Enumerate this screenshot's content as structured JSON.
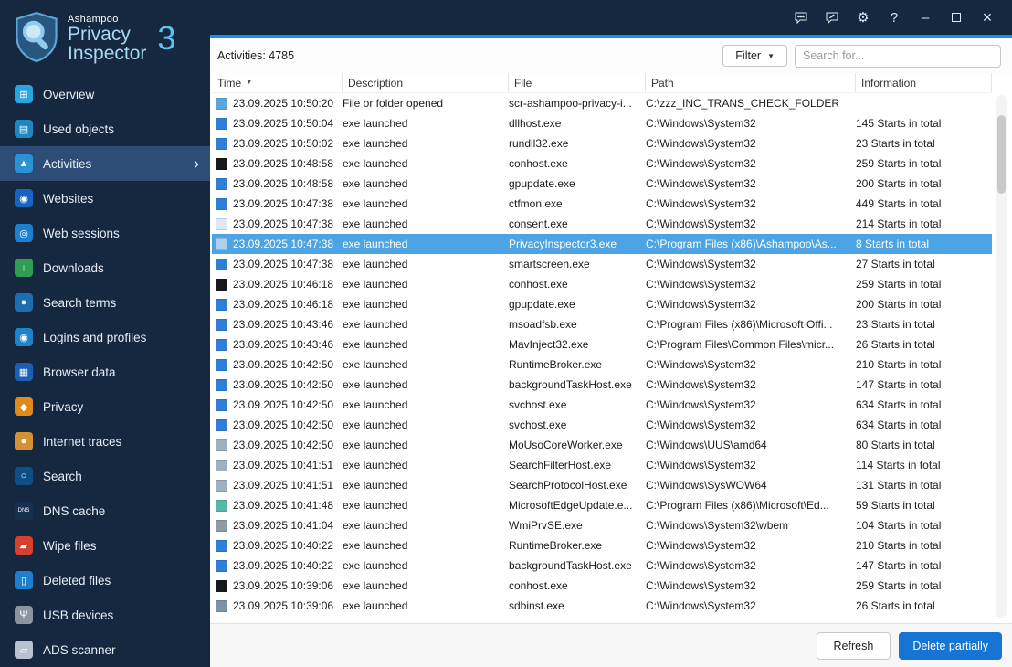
{
  "logo": {
    "brand": "Ashampoo",
    "line1": "Privacy",
    "line2": "Inspector",
    "version": "3"
  },
  "titlebar": {
    "settings_glyph": "⚙",
    "help_glyph": "?",
    "minimize_glyph": "–",
    "close_glyph": "×"
  },
  "sidebar": {
    "chevron": "›",
    "items": [
      {
        "label": "Overview",
        "icon": "overview-icon",
        "color": "#2aa3e0",
        "glyph": "⊞",
        "selected": false
      },
      {
        "label": "Used objects",
        "icon": "used-objects-icon",
        "color": "#1f86c4",
        "glyph": "▤",
        "selected": false
      },
      {
        "label": "Activities",
        "icon": "activities-icon",
        "color": "#2a93d5",
        "glyph": "▲",
        "selected": true
      },
      {
        "label": "Websites",
        "icon": "websites-icon",
        "color": "#1565c0",
        "glyph": "◉",
        "selected": false
      },
      {
        "label": "Web sessions",
        "icon": "web-sessions-icon",
        "color": "#1e7fd0",
        "glyph": "◎",
        "selected": false
      },
      {
        "label": "Downloads",
        "icon": "downloads-icon",
        "color": "#2f9e53",
        "glyph": "↓",
        "selected": false
      },
      {
        "label": "Search terms",
        "icon": "search-terms-icon",
        "color": "#1a6fae",
        "glyph": "●",
        "selected": false
      },
      {
        "label": "Logins and profiles",
        "icon": "logins-profiles-icon",
        "color": "#1d84cc",
        "glyph": "◉",
        "selected": false
      },
      {
        "label": "Browser data",
        "icon": "browser-data-icon",
        "color": "#1a5fb4",
        "glyph": "▦",
        "selected": false
      },
      {
        "label": "Privacy",
        "icon": "privacy-icon",
        "color": "#e08a1e",
        "glyph": "◆",
        "selected": false
      },
      {
        "label": "Internet traces",
        "icon": "internet-traces-icon",
        "color": "#d69136",
        "glyph": "●",
        "selected": false
      },
      {
        "label": "Search",
        "icon": "search-icon",
        "color": "#0e4f86",
        "glyph": "○",
        "selected": false
      },
      {
        "label": "DNS cache",
        "icon": "dns-cache-icon",
        "color": "#16314e",
        "glyph": "DNS",
        "selected": false
      },
      {
        "label": "Wipe files",
        "icon": "wipe-files-icon",
        "color": "#d6402f",
        "glyph": "▰",
        "selected": false
      },
      {
        "label": "Deleted files",
        "icon": "deleted-files-icon",
        "color": "#1e7fd0",
        "glyph": "▯",
        "selected": false
      },
      {
        "label": "USB devices",
        "icon": "usb-devices-icon",
        "color": "#8a959e",
        "glyph": "Ψ",
        "selected": false
      },
      {
        "label": "ADS scanner",
        "icon": "ads-scanner-icon",
        "color": "#b9c3cd",
        "glyph": "▱",
        "selected": false
      }
    ]
  },
  "toolbar": {
    "count_label": "Activities: 4785",
    "filter_label": "Filter",
    "filter_arrow": "▼",
    "search_placeholder": "Search for..."
  },
  "table": {
    "sort_glyph": "▼",
    "columns": [
      {
        "label": "Time",
        "sorted": true
      },
      {
        "label": "Description",
        "sorted": false
      },
      {
        "label": "File",
        "sorted": false
      },
      {
        "label": "Path",
        "sorted": false
      },
      {
        "label": "Information",
        "sorted": false
      }
    ],
    "rows": [
      {
        "time": "23.09.2025 10:50:20",
        "description": "File or folder opened",
        "file": "scr-ashampoo-privacy-i...",
        "path": "C:\\zzz_INC_TRANS_CHECK_FOLDER",
        "info": "",
        "icon_color": "#5aa7e0",
        "selected": false
      },
      {
        "time": "23.09.2025 10:50:04",
        "description": "exe launched",
        "file": "dllhost.exe",
        "path": "C:\\Windows\\System32",
        "info": "145 Starts in total",
        "icon_color": "#2f7fd6",
        "selected": false
      },
      {
        "time": "23.09.2025 10:50:02",
        "description": "exe launched",
        "file": "rundll32.exe",
        "path": "C:\\Windows\\System32",
        "info": "23 Starts in total",
        "icon_color": "#2f7fd6",
        "selected": false
      },
      {
        "time": "23.09.2025 10:48:58",
        "description": "exe launched",
        "file": "conhost.exe",
        "path": "C:\\Windows\\System32",
        "info": "259 Starts in total",
        "icon_color": "#15181c",
        "selected": false
      },
      {
        "time": "23.09.2025 10:48:58",
        "description": "exe launched",
        "file": "gpupdate.exe",
        "path": "C:\\Windows\\System32",
        "info": "200 Starts in total",
        "icon_color": "#2f7fd6",
        "selected": false
      },
      {
        "time": "23.09.2025 10:47:38",
        "description": "exe launched",
        "file": "ctfmon.exe",
        "path": "C:\\Windows\\System32",
        "info": "449 Starts in total",
        "icon_color": "#2f7fd6",
        "selected": false
      },
      {
        "time": "23.09.2025 10:47:38",
        "description": "exe launched",
        "file": "consent.exe",
        "path": "C:\\Windows\\System32",
        "info": "214 Starts in total",
        "icon_color": "#dfe9f4",
        "selected": false
      },
      {
        "time": "23.09.2025 10:47:38",
        "description": "exe launched",
        "file": "PrivacyInspector3.exe",
        "path": "C:\\Program Files (x86)\\Ashampoo\\As...",
        "info": "8 Starts in total",
        "icon_color": "#a9d0ef",
        "selected": true
      },
      {
        "time": "23.09.2025 10:47:38",
        "description": "exe launched",
        "file": "smartscreen.exe",
        "path": "C:\\Windows\\System32",
        "info": "27 Starts in total",
        "icon_color": "#2f7fd6",
        "selected": false
      },
      {
        "time": "23.09.2025 10:46:18",
        "description": "exe launched",
        "file": "conhost.exe",
        "path": "C:\\Windows\\System32",
        "info": "259 Starts in total",
        "icon_color": "#15181c",
        "selected": false
      },
      {
        "time": "23.09.2025 10:46:18",
        "description": "exe launched",
        "file": "gpupdate.exe",
        "path": "C:\\Windows\\System32",
        "info": "200 Starts in total",
        "icon_color": "#2f7fd6",
        "selected": false
      },
      {
        "time": "23.09.2025 10:43:46",
        "description": "exe launched",
        "file": "msoadfsb.exe",
        "path": "C:\\Program Files (x86)\\Microsoft Offi...",
        "info": "23 Starts in total",
        "icon_color": "#2f7fd6",
        "selected": false
      },
      {
        "time": "23.09.2025 10:43:46",
        "description": "exe launched",
        "file": "MavInject32.exe",
        "path": "C:\\Program Files\\Common Files\\micr...",
        "info": "26 Starts in total",
        "icon_color": "#2f7fd6",
        "selected": false
      },
      {
        "time": "23.09.2025 10:42:50",
        "description": "exe launched",
        "file": "RuntimeBroker.exe",
        "path": "C:\\Windows\\System32",
        "info": "210 Starts in total",
        "icon_color": "#2f7fd6",
        "selected": false
      },
      {
        "time": "23.09.2025 10:42:50",
        "description": "exe launched",
        "file": "backgroundTaskHost.exe",
        "path": "C:\\Windows\\System32",
        "info": "147 Starts in total",
        "icon_color": "#2f7fd6",
        "selected": false
      },
      {
        "time": "23.09.2025 10:42:50",
        "description": "exe launched",
        "file": "svchost.exe",
        "path": "C:\\Windows\\System32",
        "info": "634 Starts in total",
        "icon_color": "#2f7fd6",
        "selected": false
      },
      {
        "time": "23.09.2025 10:42:50",
        "description": "exe launched",
        "file": "svchost.exe",
        "path": "C:\\Windows\\System32",
        "info": "634 Starts in total",
        "icon_color": "#2f7fd6",
        "selected": false
      },
      {
        "time": "23.09.2025 10:42:50",
        "description": "exe launched",
        "file": "MoUsoCoreWorker.exe",
        "path": "C:\\Windows\\UUS\\amd64",
        "info": "80 Starts in total",
        "icon_color": "#9fb0c0",
        "selected": false
      },
      {
        "time": "23.09.2025 10:41:51",
        "description": "exe launched",
        "file": "SearchFilterHost.exe",
        "path": "C:\\Windows\\System32",
        "info": "114 Starts in total",
        "icon_color": "#9fb0c0",
        "selected": false
      },
      {
        "time": "23.09.2025 10:41:51",
        "description": "exe launched",
        "file": "SearchProtocolHost.exe",
        "path": "C:\\Windows\\SysWOW64",
        "info": "131 Starts in total",
        "icon_color": "#9fb0c0",
        "selected": false
      },
      {
        "time": "23.09.2025 10:41:48",
        "description": "exe launched",
        "file": "MicrosoftEdgeUpdate.e...",
        "path": "C:\\Program Files (x86)\\Microsoft\\Ed...",
        "info": "59 Starts in total",
        "icon_color": "#57b8a8",
        "selected": false
      },
      {
        "time": "23.09.2025 10:41:04",
        "description": "exe launched",
        "file": "WmiPrvSE.exe",
        "path": "C:\\Windows\\System32\\wbem",
        "info": "104 Starts in total",
        "icon_color": "#8f9aa6",
        "selected": false
      },
      {
        "time": "23.09.2025 10:40:22",
        "description": "exe launched",
        "file": "RuntimeBroker.exe",
        "path": "C:\\Windows\\System32",
        "info": "210 Starts in total",
        "icon_color": "#2f7fd6",
        "selected": false
      },
      {
        "time": "23.09.2025 10:40:22",
        "description": "exe launched",
        "file": "backgroundTaskHost.exe",
        "path": "C:\\Windows\\System32",
        "info": "147 Starts in total",
        "icon_color": "#2f7fd6",
        "selected": false
      },
      {
        "time": "23.09.2025 10:39:06",
        "description": "exe launched",
        "file": "conhost.exe",
        "path": "C:\\Windows\\System32",
        "info": "259 Starts in total",
        "icon_color": "#15181c",
        "selected": false
      },
      {
        "time": "23.09.2025 10:39:06",
        "description": "exe launched",
        "file": "sdbinst.exe",
        "path": "C:\\Windows\\System32",
        "info": "26 Starts in total",
        "icon_color": "#7f93a6",
        "selected": false
      }
    ]
  },
  "footer": {
    "refresh_label": "Refresh",
    "delete_label": "Delete partially"
  }
}
